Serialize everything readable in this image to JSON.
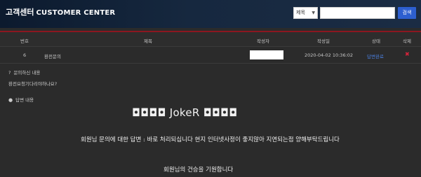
{
  "header": {
    "title": "고객센터",
    "subtitle": "CUSTOMER CENTER",
    "search_select": "제목",
    "search_value": "",
    "search_button": "검색"
  },
  "table": {
    "columns": {
      "no": "번호",
      "title": "제목",
      "author": "작성자",
      "date": "작성일",
      "status": "상태",
      "delete": "삭제"
    },
    "row": {
      "no": "6",
      "title": "환전문의",
      "author": "",
      "date": "2020-04-02 10:36:02",
      "status": "답변완료",
      "delete_icon": "✖"
    }
  },
  "inquiry": {
    "label": "문의하신 내용",
    "body": "환전요청기다리야하나요?"
  },
  "answer": {
    "label": "답변 내용",
    "joker_line": "◘◘◘◘  JokeR  ◘◘◘◘",
    "message": "회원님 문의에 대한 답변 : 바로 처리되십니다 현지 인터넷사정이 좋지않아 지연되는점 양해부탁드립니다",
    "closing": "회원님의 건승을 기원합니다"
  },
  "colors": {
    "accent_red": "#8c1620",
    "button_blue": "#2d5fd0",
    "link_blue": "#4a7fe0",
    "delete_red": "#d8233b"
  }
}
